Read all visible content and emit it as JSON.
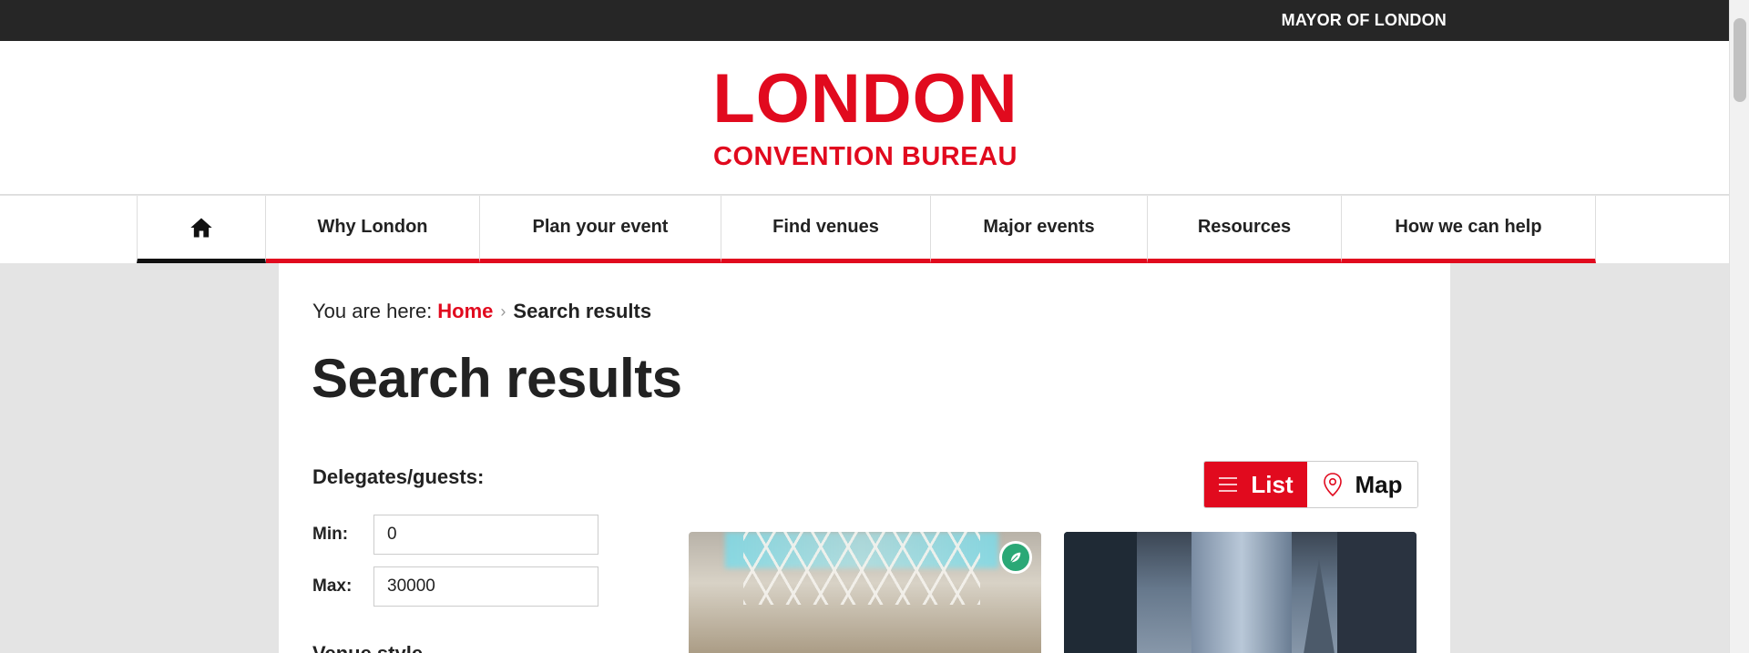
{
  "topbar": {
    "mayor_label": "MAYOR OF LONDON"
  },
  "logo": {
    "line1": "LONDON",
    "line2": "CONVENTION BUREAU"
  },
  "nav": {
    "home_icon": "home-icon",
    "items": [
      {
        "label": "Why London"
      },
      {
        "label": "Plan your event"
      },
      {
        "label": "Find venues"
      },
      {
        "label": "Major events"
      },
      {
        "label": "Resources"
      },
      {
        "label": "How we can help"
      }
    ]
  },
  "breadcrumb": {
    "prefix": "You are here:",
    "home": "Home",
    "separator": "›",
    "current": "Search results"
  },
  "page": {
    "title": "Search results"
  },
  "filters": {
    "delegates_title": "Delegates/guests:",
    "min_label": "Min:",
    "min_value": "0",
    "max_label": "Max:",
    "max_value": "30000",
    "next_section": "Venue style"
  },
  "view_toggle": {
    "list_label": "List",
    "map_label": "Map",
    "selected": "List"
  },
  "results": [
    {
      "image": "conference-hall-image",
      "badge": "eco-leaf-icon"
    },
    {
      "image": "city-skyscrapers-image"
    }
  ],
  "colors": {
    "brand_red": "#e10a1e",
    "topbar_dark": "#262626",
    "eco_green": "#2aa876"
  }
}
